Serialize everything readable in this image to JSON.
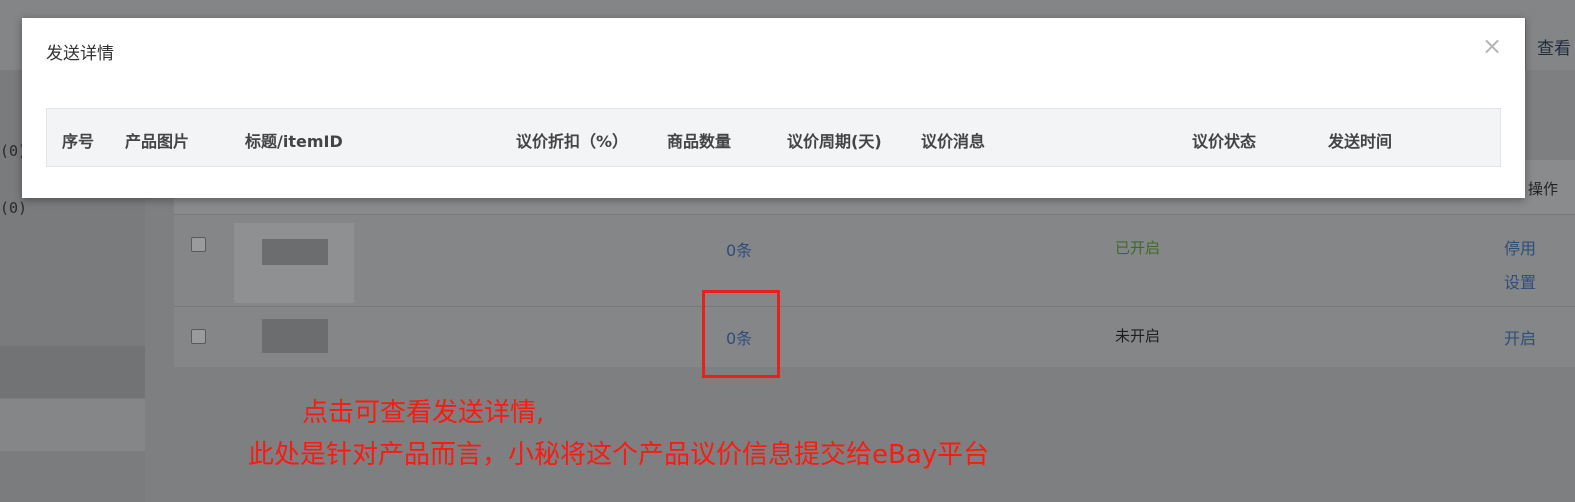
{
  "modal": {
    "title": "发送详情",
    "close": "×",
    "columns": [
      "序号",
      "产品图片",
      "标题/itemID",
      "议价折扣（%）",
      "商品数量",
      "议价周期(天)",
      "议价消息",
      "议价状态",
      "发送时间"
    ]
  },
  "background": {
    "right_link": "查看",
    "sidebar_counts": [
      "(0)",
      "(0)"
    ],
    "table_header_op": "操作",
    "rows": [
      {
        "count": "0条",
        "status": "已开启",
        "status_color": "#3f6b2a",
        "actions": [
          "停用",
          "设置"
        ]
      },
      {
        "count": "0条",
        "status": "未开启",
        "status_color": "#1e1e1e",
        "actions": [
          "开启"
        ]
      }
    ]
  },
  "annotation": {
    "line1": "点击可查看发送详情,",
    "line2": "此处是针对产品而言，小秘将这个产品议价信息提交给eBay平台",
    "color": "#ff1a0f"
  }
}
